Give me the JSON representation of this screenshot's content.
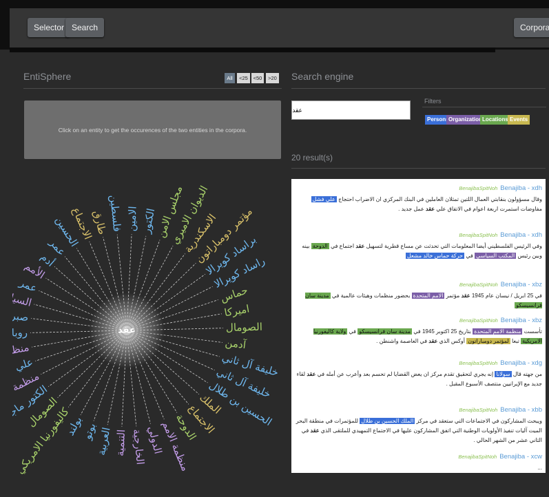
{
  "nav": {
    "selector_label": "Selector",
    "search_label": "Search",
    "corpora_label": "Corpora"
  },
  "entisphere": {
    "title": "EntiSphere",
    "range_buttons": [
      "All",
      "<25",
      "<50",
      ">20"
    ],
    "message": "Click on an entity to get the occurences of the two entities in the corpora.",
    "center_label": "عقد",
    "entities": [
      {
        "text": "مجلس الامن",
        "color": "#a9d26b"
      },
      {
        "text": "الديوان الاميري",
        "color": "#a9d26b"
      },
      {
        "text": "الاسكندرية",
        "color": "#d9c16a"
      },
      {
        "text": "مؤتمر دومباراتون",
        "color": "#d9c16a"
      },
      {
        "text": "براساد كويرالا",
        "color": "#6fb8ef"
      },
      {
        "text": "راساد كويرالا",
        "color": "#6fb8ef"
      },
      {
        "text": "حماس",
        "color": "#a9d26b"
      },
      {
        "text": "اميركا",
        "color": "#a9d26b"
      },
      {
        "text": "الصومال",
        "color": "#a9d26b"
      },
      {
        "text": "آدمن",
        "color": "#a9d26b"
      },
      {
        "text": "بن خليفة آل ثاني",
        "color": "#6fb8ef"
      },
      {
        "text": "خليفة آل ثاني",
        "color": "#6fb8ef"
      },
      {
        "text": "الحسين بن طلال",
        "color": "#6fb8ef"
      },
      {
        "text": "الملك",
        "color": "#d9c16a"
      },
      {
        "text": "الاجتماع",
        "color": "#d9c16a"
      },
      {
        "text": "الدوحة",
        "color": "#a9d26b"
      },
      {
        "text": "منظمة الامم",
        "color": "#c29ce8"
      },
      {
        "text": "الدولي",
        "color": "#c29ce8"
      },
      {
        "text": "الخارجية",
        "color": "#c29ce8"
      },
      {
        "text": "التنمية",
        "color": "#c29ce8"
      },
      {
        "text": "العربية",
        "color": "#6fb8ef"
      },
      {
        "text": "بوتو",
        "color": "#6fb8ef"
      },
      {
        "text": "بولند",
        "color": "#6fb8ef"
      },
      {
        "text": "كاليفورنيا الامريكي",
        "color": "#a9d26b"
      },
      {
        "text": "الصومال",
        "color": "#a9d26b"
      },
      {
        "text": "الكتور ماجد",
        "color": "#6fb8ef"
      },
      {
        "text": "منظمة الدول",
        "color": "#c29ce8"
      },
      {
        "text": "علي عقد",
        "color": "#6fb8ef"
      },
      {
        "text": "منظمة التحرير",
        "color": "#c29ce8"
      },
      {
        "text": "روبا",
        "color": "#6fb8ef"
      },
      {
        "text": "صبري",
        "color": "#6fb8ef"
      },
      {
        "text": "السياسي",
        "color": "#c29ce8"
      },
      {
        "text": "عمر",
        "color": "#6fb8ef"
      },
      {
        "text": "الأمم",
        "color": "#c29ce8"
      },
      {
        "text": "أدم",
        "color": "#6fb8ef"
      },
      {
        "text": "عمر",
        "color": "#6fb8ef"
      },
      {
        "text": "الحسين",
        "color": "#6fb8ef"
      },
      {
        "text": "الاجتماع",
        "color": "#d9c16a"
      },
      {
        "text": "طارق",
        "color": "#d9c16a"
      },
      {
        "text": "فلسطين",
        "color": "#6fb8ef"
      },
      {
        "text": "الامين",
        "color": "#6fb8ef"
      },
      {
        "text": "الكتور",
        "color": "#6fb8ef"
      }
    ]
  },
  "search": {
    "title": "Search engine",
    "query": "عقد",
    "filters_label": "Filters",
    "filter_buttons": [
      {
        "label": "Persons",
        "color": "#3a6fd8"
      },
      {
        "label": "Organization",
        "color": "#7b5ea7"
      },
      {
        "label": "Locations",
        "color": "#6aa84f"
      },
      {
        "label": "Events",
        "color": "#c8b850"
      }
    ],
    "result_count": "20 result(s)",
    "results": [
      {
        "source": "BenajibaSpitNoh",
        "id": "Benajiba - xdh",
        "parts": [
          [
            "t",
            "وقال مسؤولون بنقابتي العمال اللتين تمثلان العاملين في البنك المركزي ان الاضراب احتجاج "
          ],
          [
            "p",
            "علي فشل"
          ],
          [
            "t",
            " مفاوضات استمرت اربعة اعوام في الاتفاق علي "
          ],
          [
            "k",
            "عقد"
          ],
          [
            "t",
            " عمل جديد ."
          ]
        ]
      },
      {
        "source": "BenajibaSpitNoh",
        "id": "Benajiba - xdh",
        "parts": [
          [
            "t",
            "وفي الرئيس الفلسطيني أيضا المعلومات التي تحدثت عن مساع قطرية لتسهيل "
          ],
          [
            "k",
            "عقد"
          ],
          [
            "t",
            " اجتماع في "
          ],
          [
            "l",
            "الدوحة"
          ],
          [
            "t",
            " بينه وبين رئيس "
          ],
          [
            "o",
            "المكتب السياسي"
          ],
          [
            "t",
            " في "
          ],
          [
            "p",
            "حركة حماس خالد مشعل"
          ]
        ]
      },
      {
        "source": "BenajibaSpitNoh",
        "id": "Benajiba - xbz",
        "parts": [
          [
            "t",
            "في 25 ابريل / نيسان عام 1945 "
          ],
          [
            "k",
            "عقد"
          ],
          [
            "t",
            " مؤتمر "
          ],
          [
            "o",
            "الامم المتحدة"
          ],
          [
            "t",
            " بحضور منظمات وهيئات عالمية في "
          ],
          [
            "l",
            "مدينة سان فرانسيسكو"
          ]
        ]
      },
      {
        "source": "BenajibaSpitNoh",
        "id": "Benajiba - xbz",
        "parts": [
          [
            "t",
            "تأسست "
          ],
          [
            "o",
            "منظمة الامم المتحدة"
          ],
          [
            "t",
            " بتاريخ 25 اكتوبر 1945 في "
          ],
          [
            "l",
            "مدينة سان فرانسيسكو"
          ],
          [
            "t",
            " في "
          ],
          [
            "l",
            "ولاية كاليفورنيا الامريكية"
          ],
          [
            "t",
            " تبعا "
          ],
          [
            "e",
            "لمؤتمر دومباراتون"
          ],
          [
            "t",
            " أوكس الذي "
          ],
          [
            "k",
            "عقد"
          ],
          [
            "t",
            " في العاصمة واشنطن ."
          ]
        ]
      },
      {
        "source": "BenajibaSpitNoh",
        "id": "Benajiba - xdg",
        "parts": [
          [
            "t",
            "من جهته قال "
          ],
          [
            "p",
            "سولانا"
          ],
          [
            "t",
            " إنه يجري لتحقيق تقدم مركز ان يعض القضايا لم تحسم بعد وأعرب عن أمله في "
          ],
          [
            "k",
            "عقد"
          ],
          [
            "t",
            " لقاء جديد مع الإيرانيين منتصف الأسبوع المقبل ."
          ]
        ]
      },
      {
        "source": "BenajibaSpitNoh",
        "id": "Benajiba - xbb",
        "parts": [
          [
            "t",
            "ويبحث المشاركون في الاجتماعات التي ستعقد في مركز "
          ],
          [
            "p",
            "الملك الحسين بن طلال"
          ],
          [
            "t",
            " للمؤتمرات في منطقة البحر الميت آليات تنفيذ الأولويات الوطنية التي اتفق المشاركون عليها في الاجتماع التمهيدي للملتقى الذي "
          ],
          [
            "k",
            "عقد"
          ],
          [
            "t",
            " في الثاني عشر من الشهر الحالي ."
          ]
        ]
      },
      {
        "source": "BenajibaSpitNoh",
        "id": "Benajiba - xcw",
        "parts": [
          [
            "t",
            "..."
          ]
        ]
      }
    ]
  }
}
